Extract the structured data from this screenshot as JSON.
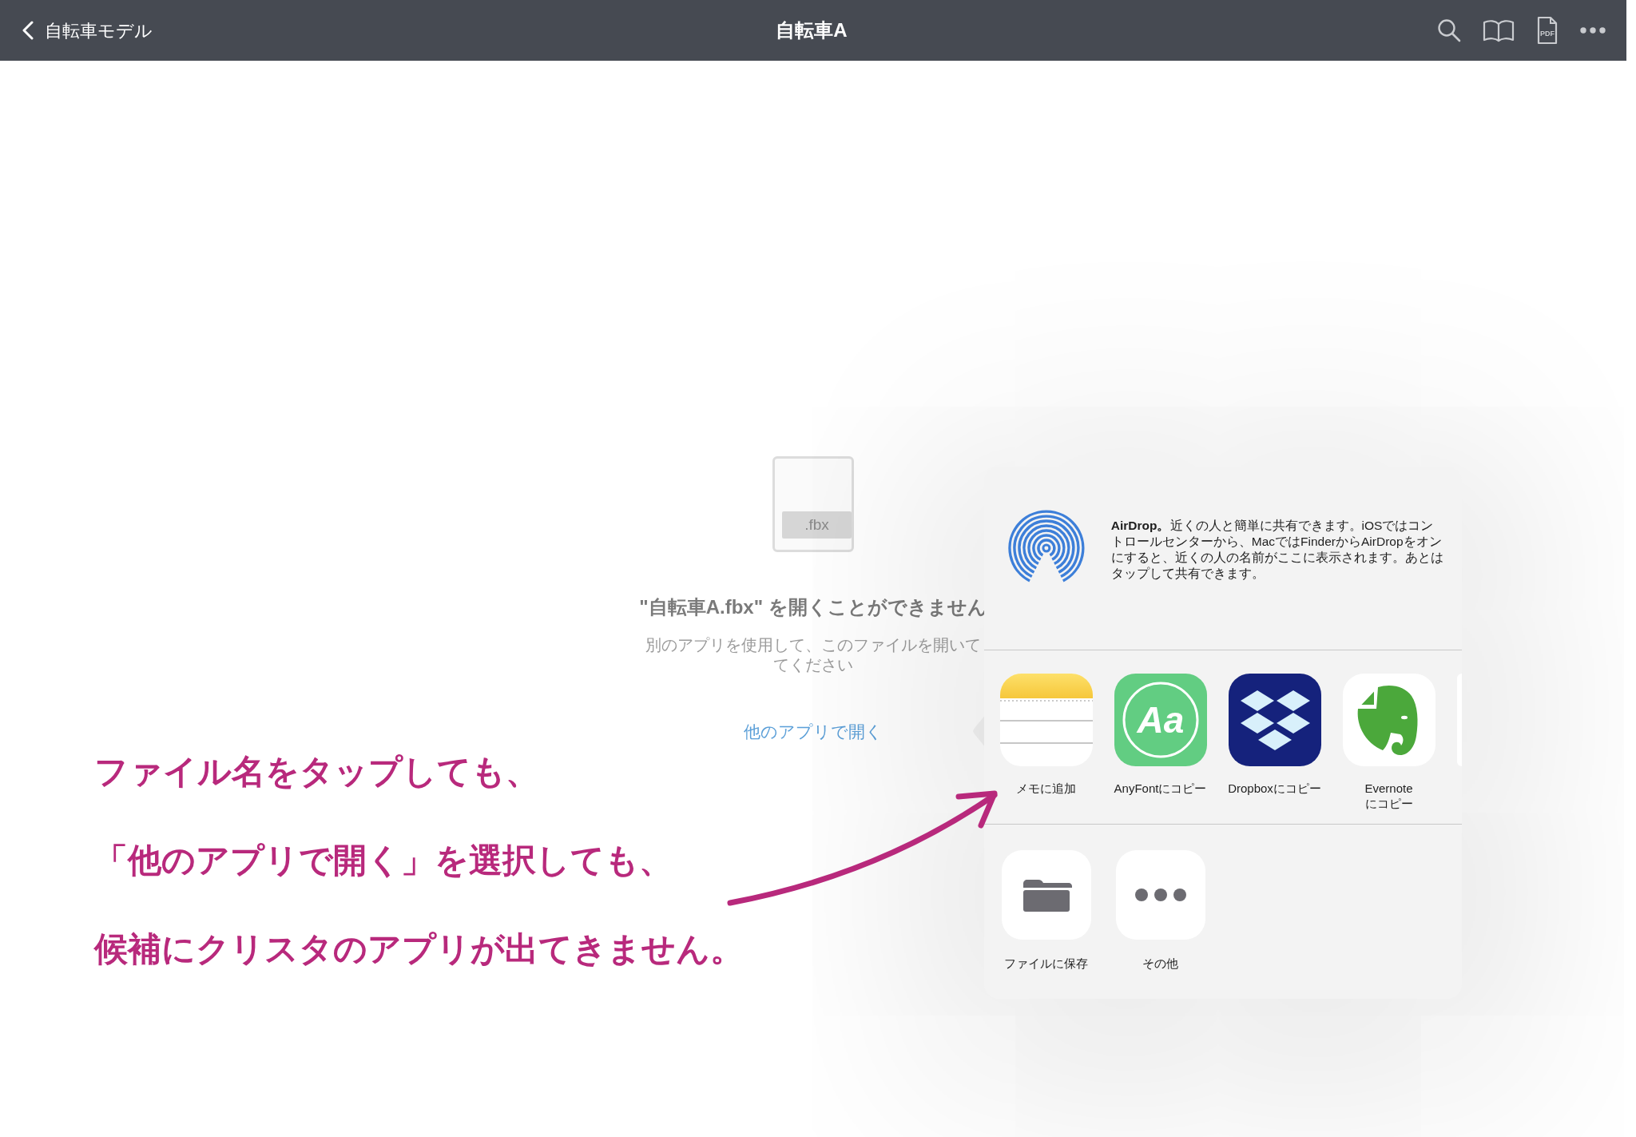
{
  "navbar": {
    "back_label": "自転車モデル",
    "title": "自転車A",
    "tools": [
      {
        "kind": "search"
      },
      {
        "kind": "book"
      },
      {
        "kind": "pdf",
        "label": "PDF"
      },
      {
        "kind": "more"
      }
    ]
  },
  "file_notice": {
    "extension": ".fbx",
    "title": "\"自転車A.fbx\" を開くことができません",
    "message_lines": [
      "別のアプリを使用して、このファイルを開いて",
      "てください"
    ],
    "link": "他のアプリで開く"
  },
  "share_sheet": {
    "airdrop_text": "**AirDrop。**近くの人と簡単に共有できます。iOSではコントロールセンターから、MacではFinderからAirDropをオンにすると、近くの人の名前がここに表示されます。あとはタップして共有できます。",
    "apps": [
      {
        "kind": "notes",
        "label": "メモに追加"
      },
      {
        "kind": "font",
        "glyph": "Aa",
        "label": "AnyFontにコピー"
      },
      {
        "kind": "box",
        "label": "Dropboxにコピー"
      },
      {
        "kind": "elephant",
        "label": "Evernoteにコピー"
      }
    ],
    "actions": [
      {
        "kind": "folder",
        "label": "ファイルに保存"
      },
      {
        "kind": "more",
        "label": "その他"
      }
    ]
  },
  "annotation": {
    "lines": [
      "ファイル名をタップしても、",
      "「他のアプリで開く」を選択しても、",
      "候補にクリスタのアプリが出てきません。"
    ]
  }
}
